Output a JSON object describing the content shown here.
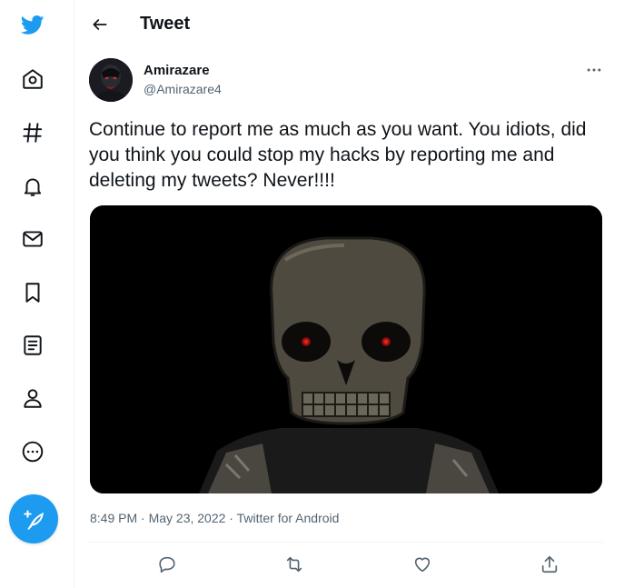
{
  "nav": {
    "items": [
      {
        "icon": "twitter-logo-icon"
      },
      {
        "icon": "home-icon"
      },
      {
        "icon": "explore-hashtag-icon"
      },
      {
        "icon": "notifications-bell-icon"
      },
      {
        "icon": "messages-envelope-icon"
      },
      {
        "icon": "bookmarks-icon"
      },
      {
        "icon": "lists-icon"
      },
      {
        "icon": "profile-icon"
      },
      {
        "icon": "more-circle-icon"
      }
    ],
    "compose_icon": "compose-tweet-icon"
  },
  "header": {
    "title": "Tweet",
    "back_icon": "back-arrow-icon"
  },
  "tweet": {
    "author_name": "Amirazare",
    "author_handle": "@Amirazare4",
    "text": "Continue to report me as much as you want. You idiots, did you think you could stop my hacks by reporting me and deleting my tweets?  Never!!!!",
    "timestamp": "8:49 PM · May 23, 2022 · Twitter for Android",
    "media": {
      "description_icon": "skull-image"
    }
  },
  "actions": [
    {
      "icon": "reply-icon"
    },
    {
      "icon": "retweet-icon"
    },
    {
      "icon": "like-heart-icon"
    },
    {
      "icon": "share-icon"
    }
  ],
  "colors": {
    "brand": "#1d9bf0",
    "text": "#0f1419",
    "secondary": "#536471",
    "border": "#eff3f4"
  }
}
